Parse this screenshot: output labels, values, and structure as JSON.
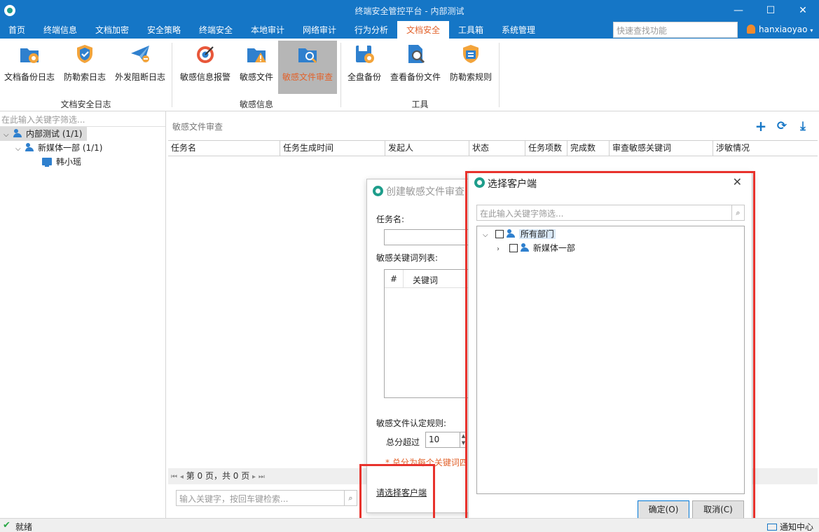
{
  "app": {
    "title": "终端安全管控平台 - 内部测试",
    "window_controls": {
      "minimize": "—",
      "maximize": "☐",
      "close": "✕"
    }
  },
  "menu": {
    "items": [
      "首页",
      "终端信息",
      "文档加密",
      "安全策略",
      "终端安全",
      "本地审计",
      "网络审计",
      "行为分析",
      "文档安全",
      "工具箱",
      "系统管理"
    ],
    "active_index": 8,
    "quick_search_placeholder": "快速查找功能",
    "user": "hanxiaoyao"
  },
  "ribbon": {
    "buttons": [
      {
        "label": "文档备份日志",
        "icon": "folder-backup-icon"
      },
      {
        "label": "防勒索日志",
        "icon": "shield-check-icon"
      },
      {
        "label": "外发阻断日志",
        "icon": "paper-plane-icon"
      },
      {
        "label": "敏感信息报警",
        "icon": "target-alarm-icon"
      },
      {
        "label": "敏感文件",
        "icon": "folder-warning-icon"
      },
      {
        "label": "敏感文件审查",
        "icon": "folder-inspect-icon"
      },
      {
        "label": "全盘备份",
        "icon": "disk-backup-icon"
      },
      {
        "label": "查看备份文件",
        "icon": "document-search-icon"
      },
      {
        "label": "防勒索规则",
        "icon": "shield-rule-icon"
      }
    ],
    "active_index": 5,
    "groups": [
      "文档安全日志",
      "敏感信息",
      "工具"
    ],
    "accent": "#e2622b"
  },
  "left": {
    "filter_placeholder": "在此输入关键字筛选...",
    "tree": [
      {
        "label": "内部测试 (1/1)",
        "level": 0
      },
      {
        "label": "新媒体一部 (1/1)",
        "level": 1
      },
      {
        "label": "韩小瑶",
        "level": 2
      }
    ]
  },
  "main": {
    "title": "敏感文件审查",
    "columns": [
      "任务名",
      "任务生成时间",
      "发起人",
      "状态",
      "任务项数",
      "完成数",
      "审查敏感关键词",
      "涉敏情况"
    ],
    "pager": "第 0 页，共 0 页",
    "search_placeholder": "输入关键字，按回车键检索..."
  },
  "create_dialog": {
    "title": "创建敏感文件审查",
    "task_name_label": "任务名:",
    "keyword_list_label": "敏感关键词列表:",
    "kw_columns": [
      "#",
      "关键词"
    ],
    "rule_label": "敏感文件认定规则:",
    "score_label": "总分超过",
    "score_value": "10",
    "hint": "* 总分为每个关键词四",
    "select_client_link": "请选择客户端"
  },
  "select_dialog": {
    "title": "选择客户端",
    "filter_placeholder": "在此输入关键字筛选...",
    "tree": [
      {
        "label": "所有部门",
        "expanded": true
      },
      {
        "label": "新媒体一部",
        "expanded": false
      }
    ],
    "ok": "确定(O)",
    "cancel": "取消(C)"
  },
  "status": {
    "text": "就绪",
    "notice": "通知中心"
  }
}
